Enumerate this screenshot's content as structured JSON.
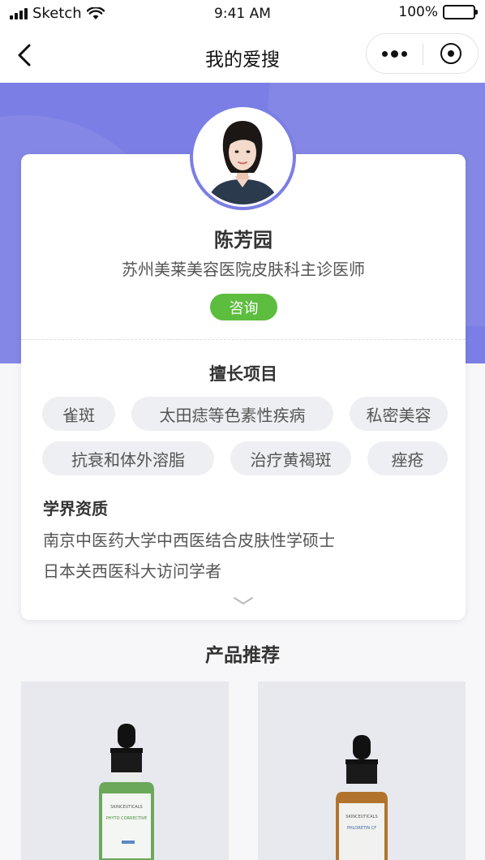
{
  "status_bar": {
    "carrier": "Sketch",
    "time": "9:41 AM",
    "battery": "100%"
  },
  "nav": {
    "title": "我的爱搜"
  },
  "doctor": {
    "name": "陈芳园",
    "title": "苏州美莱美容医院皮肤科主诊医师",
    "consult_label": "咨询"
  },
  "specialties": {
    "heading": "擅长项目",
    "tags": [
      "雀斑",
      "太田痣等色素性疾病",
      "私密美容",
      "抗衰和体外溶脂",
      "治疗黄褐斑",
      "痤疮"
    ]
  },
  "qualifications": {
    "heading": "学界资质",
    "items": [
      "南京中医药大学中西医结合皮肤性学硕士",
      "日本关西医科大访问学者"
    ]
  },
  "products": {
    "heading": "产品推荐",
    "items": [
      {
        "brand": "SKINCEUTICALS",
        "name": "PHYTO CORRECTIVE",
        "cap_color": "#000000",
        "liquid_color": "#6ba85a"
      },
      {
        "brand": "SKINCEUTICALS",
        "name": "PHLORETIN CF",
        "cap_color": "#000000",
        "liquid_color": "#b2742c"
      }
    ]
  },
  "colors": {
    "accent": "#7b7ee4",
    "consult": "#5dbd3e"
  }
}
